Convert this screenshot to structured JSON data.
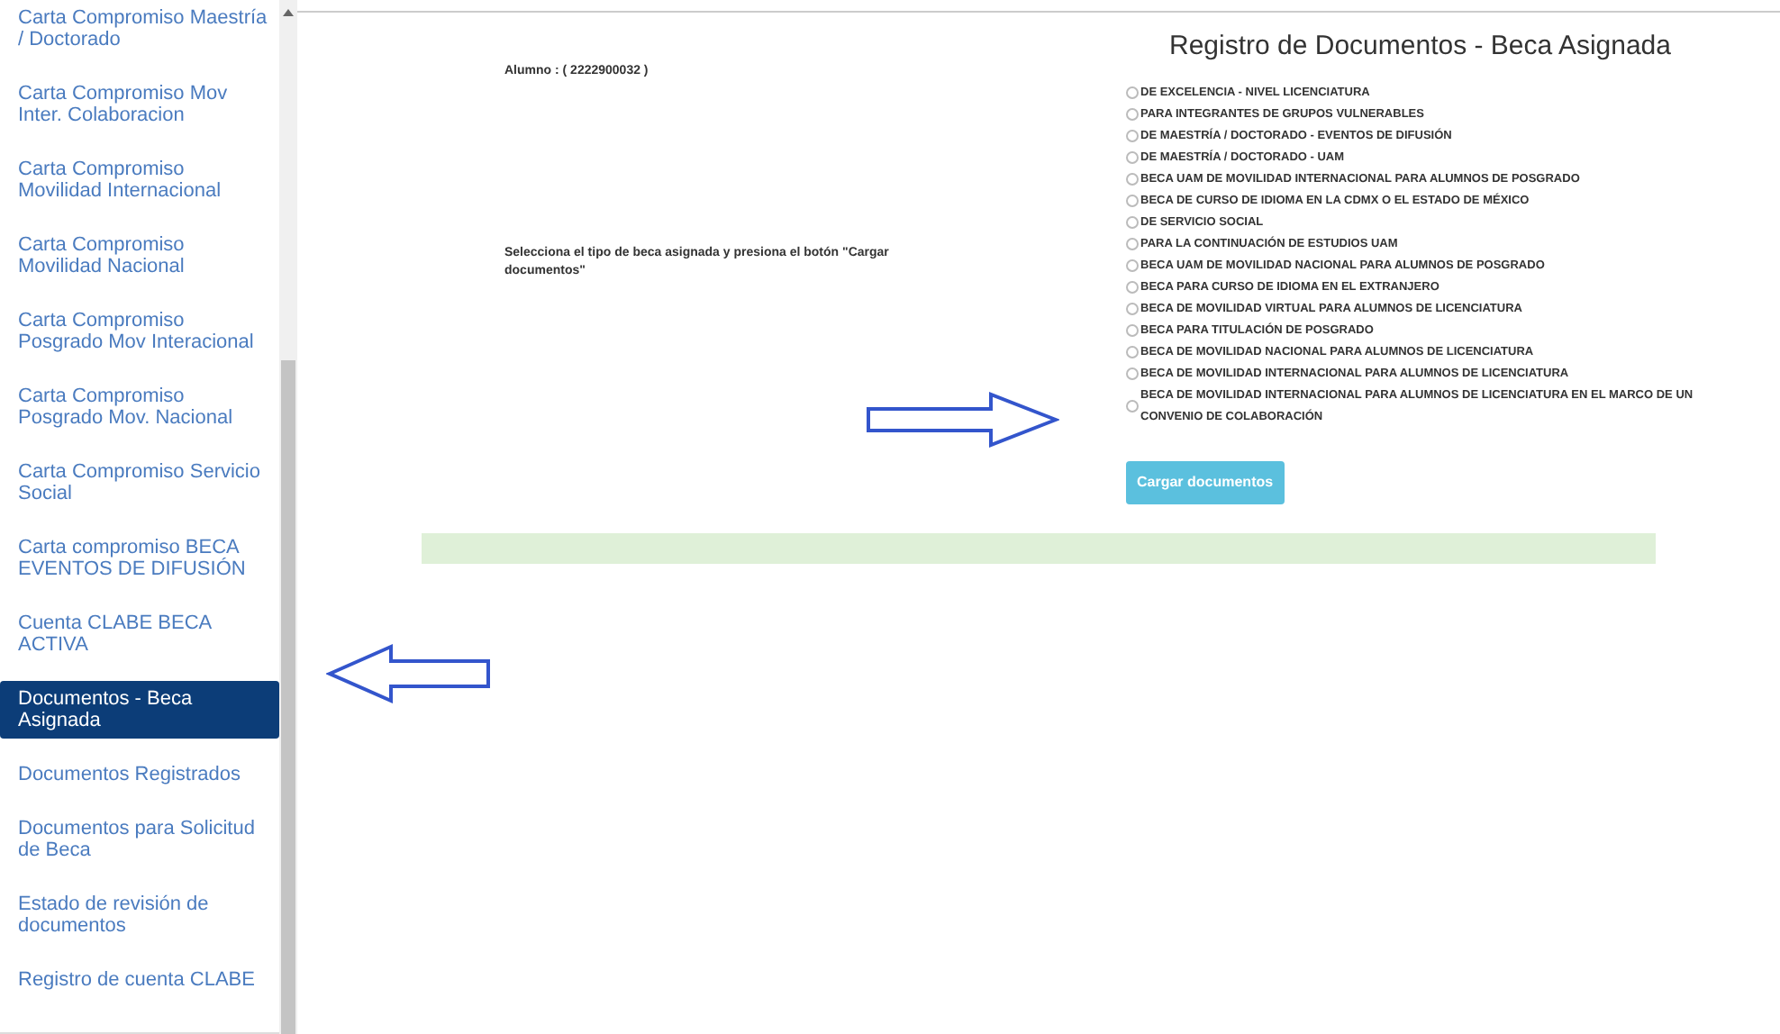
{
  "sidebar": {
    "items": [
      {
        "label": "Carta Compromiso Maestría / Doctorado",
        "selected": false
      },
      {
        "label": "Carta Compromiso Mov Inter. Colaboracion",
        "selected": false
      },
      {
        "label": "Carta Compromiso Movilidad Internacional",
        "selected": false
      },
      {
        "label": "Carta Compromiso Movilidad Nacional",
        "selected": false
      },
      {
        "label": "Carta Compromiso Posgrado Mov Interacional",
        "selected": false
      },
      {
        "label": "Carta Compromiso Posgrado Mov. Nacional",
        "selected": false
      },
      {
        "label": "Carta Compromiso Servicio Social",
        "selected": false
      },
      {
        "label": "Carta compromiso BECA EVENTOS DE DIFUSIÓN",
        "selected": false
      },
      {
        "label": "Cuenta CLABE BECA ACTIVA",
        "selected": false
      },
      {
        "label": "Documentos - Beca Asignada",
        "selected": true
      },
      {
        "label": "Documentos Registrados",
        "selected": false
      },
      {
        "label": "Documentos para Solicitud de Beca",
        "selected": false
      },
      {
        "label": "Estado de revisión de documentos",
        "selected": false
      },
      {
        "label": "Registro de cuenta CLABE",
        "selected": false
      }
    ]
  },
  "main": {
    "title": "Registro de Documentos - Beca Asignada",
    "student": "Alumno : ( 2222900032 )",
    "instruction": "Selecciona el tipo de beca asignada y presiona el botón \"Cargar documentos\"",
    "options": [
      {
        "label": "DE EXCELENCIA - NIVEL LICENCIATURA",
        "selected": false
      },
      {
        "label": "PARA INTEGRANTES DE GRUPOS VULNERABLES",
        "selected": false
      },
      {
        "label": "DE MAESTRÍA / DOCTORADO - EVENTOS DE DIFUSIÓN",
        "selected": false
      },
      {
        "label": "DE MAESTRÍA / DOCTORADO - UAM",
        "selected": false
      },
      {
        "label": "BECA UAM DE MOVILIDAD INTERNACIONAL PARA ALUMNOS DE POSGRADO",
        "selected": false
      },
      {
        "label": "BECA DE CURSO DE IDIOMA EN LA CDMX O EL ESTADO DE MÉXICO",
        "selected": false
      },
      {
        "label": "DE SERVICIO SOCIAL",
        "selected": false
      },
      {
        "label": "PARA LA CONTINUACIÓN DE ESTUDIOS UAM",
        "selected": false
      },
      {
        "label": "BECA UAM DE MOVILIDAD NACIONAL PARA ALUMNOS DE POSGRADO",
        "selected": false
      },
      {
        "label": "BECA PARA CURSO DE IDIOMA EN EL EXTRANJERO",
        "selected": false
      },
      {
        "label": "BECA DE MOVILIDAD VIRTUAL PARA ALUMNOS DE LICENCIATURA",
        "selected": false
      },
      {
        "label": "BECA PARA TITULACIÓN DE POSGRADO",
        "selected": false
      },
      {
        "label": "BECA DE MOVILIDAD NACIONAL PARA ALUMNOS DE LICENCIATURA",
        "selected": false
      },
      {
        "label": "BECA DE MOVILIDAD INTERNACIONAL PARA ALUMNOS DE LICENCIATURA",
        "selected": false
      },
      {
        "label": "BECA DE MOVILIDAD INTERNACIONAL PARA ALUMNOS DE LICENCIATURA EN EL MARCO DE UN CONVENIO DE COLABORACIÓN",
        "selected": false
      }
    ],
    "button": "Cargar documentos"
  }
}
